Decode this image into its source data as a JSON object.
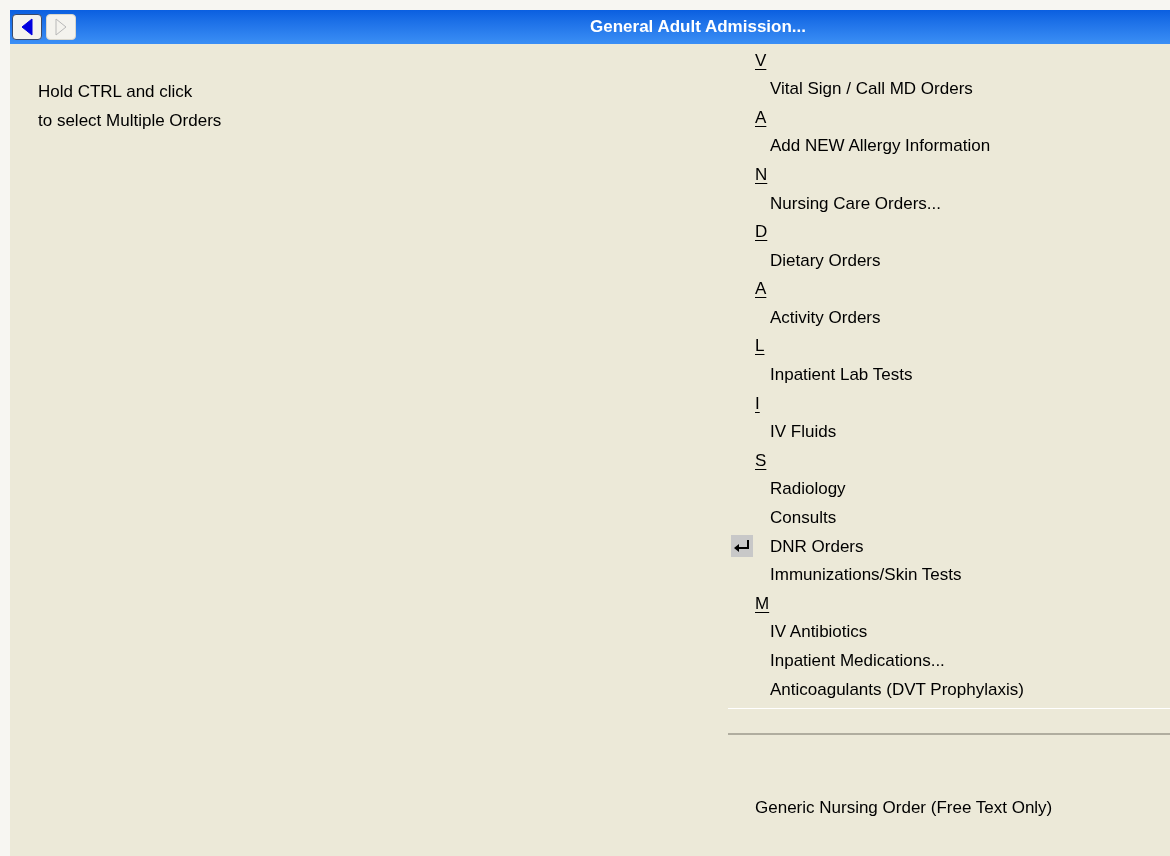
{
  "window": {
    "title": "General Adult Admission..."
  },
  "nav": {
    "back": {
      "disabled": false
    },
    "forward": {
      "disabled": true
    }
  },
  "hint": [
    "Hold CTRL and click",
    "to select Multiple Orders"
  ],
  "orders": [
    {
      "kind": "header",
      "label": "V"
    },
    {
      "kind": "item",
      "label": "Vital Sign / Call MD Orders",
      "marked": false
    },
    {
      "kind": "header",
      "label": "A"
    },
    {
      "kind": "item",
      "label": "Add NEW Allergy Information",
      "marked": false
    },
    {
      "kind": "header",
      "label": "N"
    },
    {
      "kind": "item",
      "label": "Nursing Care Orders...",
      "marked": false
    },
    {
      "kind": "header",
      "label": "D"
    },
    {
      "kind": "item",
      "label": "Dietary Orders",
      "marked": false
    },
    {
      "kind": "header",
      "label": "A"
    },
    {
      "kind": "item",
      "label": "Activity Orders",
      "marked": false
    },
    {
      "kind": "header",
      "label": "L"
    },
    {
      "kind": "item",
      "label": "Inpatient Lab Tests",
      "marked": false
    },
    {
      "kind": "header",
      "label": "I"
    },
    {
      "kind": "item",
      "label": "IV Fluids",
      "marked": false
    },
    {
      "kind": "header",
      "label": "S"
    },
    {
      "kind": "item",
      "label": "Radiology",
      "marked": false
    },
    {
      "kind": "item",
      "label": "Consults",
      "marked": false
    },
    {
      "kind": "item",
      "label": "DNR Orders",
      "marked": true
    },
    {
      "kind": "item",
      "label": "Immunizations/Skin Tests",
      "marked": false
    },
    {
      "kind": "header",
      "label": "M"
    },
    {
      "kind": "item",
      "label": "IV Antibiotics",
      "marked": false
    },
    {
      "kind": "item",
      "label": "Inpatient Medications...",
      "marked": false
    },
    {
      "kind": "item",
      "label": "Anticoagulants (DVT Prophylaxis)",
      "marked": false
    }
  ],
  "generic_order": "Generic Nursing Order (Free Text Only)"
}
